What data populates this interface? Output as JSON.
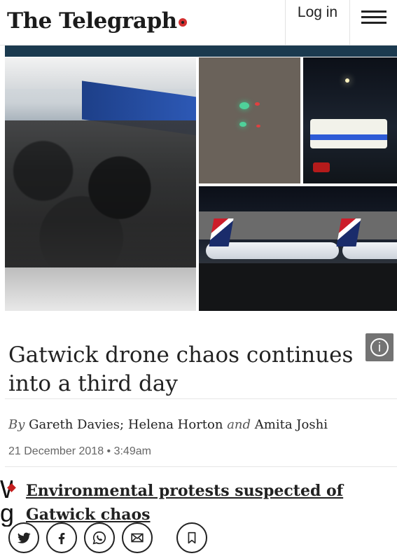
{
  "header": {
    "masthead": "The Telegraph",
    "login_label": "Log in",
    "menu_icon": "hamburger-icon"
  },
  "article": {
    "headline": "Gatwick drone chaos continues into a third day",
    "byline": {
      "prefix": "By",
      "author1": "Gareth Davies",
      "sep": ";",
      "author2": "Helena Horton",
      "and": "and",
      "author3": "Amita Joshi"
    },
    "date": "21 December 2018 • 3:49am",
    "related": "Environmental protests suspected of Gatwick chaos"
  },
  "edge_text": "W\ng",
  "photo_info_label": "i",
  "share_buttons": [
    {
      "name": "twitter-icon"
    },
    {
      "name": "facebook-icon"
    },
    {
      "name": "whatsapp-icon"
    },
    {
      "name": "email-icon"
    },
    {
      "name": "bookmark-icon"
    }
  ],
  "colors": {
    "nav_bar": "#1b3a4f",
    "bullet": "#c41e1e"
  }
}
